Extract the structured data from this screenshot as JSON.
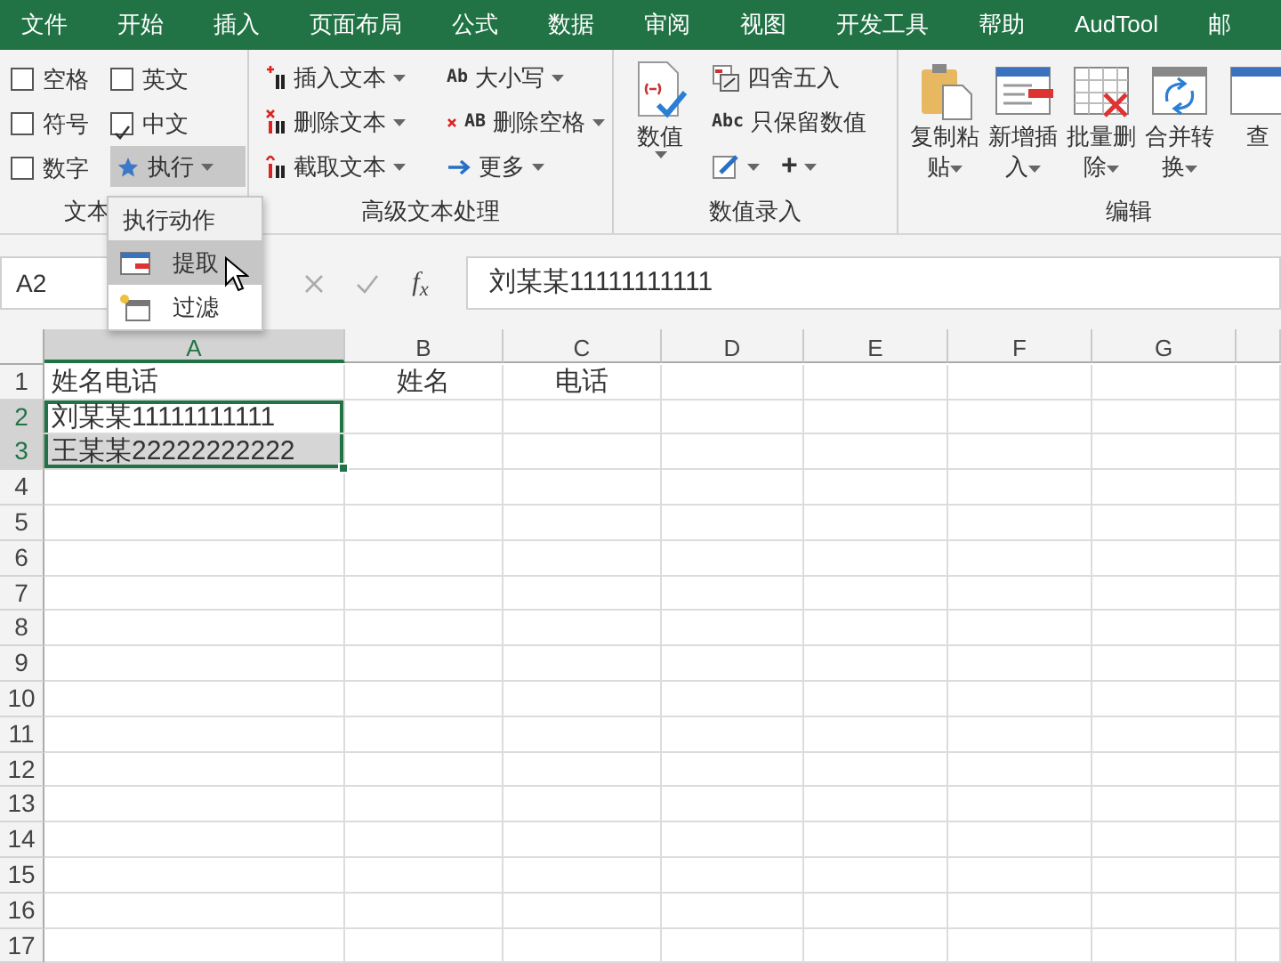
{
  "menu_tabs": [
    {
      "label": "文件"
    },
    {
      "label": "开始"
    },
    {
      "label": "插入"
    },
    {
      "label": "页面布局"
    },
    {
      "label": "公式"
    },
    {
      "label": "数据"
    },
    {
      "label": "审阅"
    },
    {
      "label": "视图"
    },
    {
      "label": "开发工具"
    },
    {
      "label": "帮助"
    },
    {
      "label": "AudTool"
    },
    {
      "label": "邮"
    }
  ],
  "ribbon": {
    "text_group": {
      "label": "文本",
      "items": [
        {
          "kind": "checkbox",
          "label": "空格",
          "checked": false
        },
        {
          "kind": "checkbox",
          "label": "符号",
          "checked": false
        },
        {
          "kind": "checkbox",
          "label": "数字",
          "checked": false
        },
        {
          "kind": "checkbox",
          "label": "英文",
          "checked": false
        },
        {
          "kind": "checkbox",
          "label": "中文",
          "checked": true
        },
        {
          "kind": "button",
          "label": "执行",
          "pressed": true
        }
      ]
    },
    "advanced_group": {
      "label": "高级文本处理",
      "items": [
        {
          "label": "插入文本"
        },
        {
          "label": "删除文本"
        },
        {
          "label": "截取文本"
        },
        {
          "label": "大小写",
          "icon_text": "Ab"
        },
        {
          "label": "删除空格",
          "icon_text": "AB"
        },
        {
          "label": "更多"
        }
      ]
    },
    "number_group": {
      "label": "数值录入",
      "big_button": {
        "label": "数值"
      },
      "items": [
        {
          "kind": "text",
          "label": "四舍五入"
        },
        {
          "kind": "text",
          "label": "只保留数值",
          "icon_text": "Abc"
        },
        {
          "kind": "icons",
          "text": "+"
        }
      ]
    },
    "edit_group": {
      "label": "编辑",
      "buttons": [
        {
          "label": "复制粘贴",
          "dropdown": true
        },
        {
          "label": "新增插入",
          "dropdown": true
        },
        {
          "label": "批量删除",
          "dropdown": true
        },
        {
          "label": "合并转换",
          "dropdown": true
        },
        {
          "label": "查",
          "dropdown": false
        }
      ]
    }
  },
  "dropdown_menu": {
    "header": "执行动作",
    "items": [
      {
        "label": "提取",
        "selected": true
      },
      {
        "label": "过滤",
        "selected": false
      }
    ]
  },
  "formula_bar": {
    "name_box": "A2",
    "fx": "f$_{x}$",
    "formula": "刘某某11111111111"
  },
  "sheet": {
    "columns": [
      {
        "label": "A",
        "selected": true
      },
      {
        "label": "B",
        "selected": false
      },
      {
        "label": "C",
        "selected": false
      },
      {
        "label": "D",
        "selected": false
      },
      {
        "label": "E",
        "selected": false
      },
      {
        "label": "F",
        "selected": false
      },
      {
        "label": "G",
        "selected": false
      }
    ],
    "rows": [
      {
        "header": "1",
        "selected": false,
        "active": false,
        "cells": [
          {
            "text": "姓名电话",
            "centered": false
          },
          {
            "text": "姓名",
            "centered": true
          },
          {
            "text": "电话",
            "centered": true
          }
        ]
      },
      {
        "header": "2",
        "selected": true,
        "active": true,
        "cells": [
          {
            "text": "刘某某11111111111",
            "centered": false
          }
        ]
      },
      {
        "header": "3",
        "selected": true,
        "active": false,
        "cells": [
          {
            "text": "王某某22222222222",
            "centered": false
          }
        ]
      },
      {
        "header": "4",
        "selected": false,
        "active": false
      },
      {
        "header": "5",
        "selected": false,
        "active": false
      },
      {
        "header": "6",
        "selected": false,
        "active": false
      },
      {
        "header": "7",
        "selected": false,
        "active": false
      },
      {
        "header": "8",
        "selected": false,
        "active": false
      },
      {
        "header": "9",
        "selected": false,
        "active": false
      },
      {
        "header": "10",
        "selected": false,
        "active": false
      },
      {
        "header": "11",
        "selected": false,
        "active": false
      },
      {
        "header": "12",
        "selected": false,
        "active": false
      },
      {
        "header": "13",
        "selected": false,
        "active": false
      },
      {
        "header": "14",
        "selected": false,
        "active": false
      },
      {
        "header": "15",
        "selected": false,
        "active": false
      },
      {
        "header": "16",
        "selected": false,
        "active": false
      },
      {
        "header": "17",
        "selected": false,
        "active": false
      }
    ]
  }
}
